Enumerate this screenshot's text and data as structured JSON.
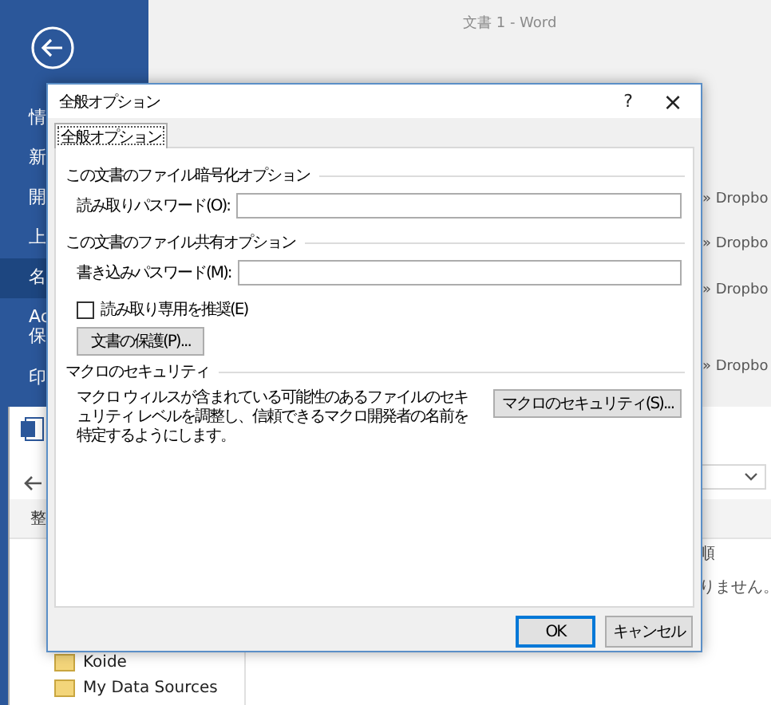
{
  "backstage": {
    "title": "文書 1 - Word",
    "sidebar": [
      {
        "label": "情",
        "selected": false
      },
      {
        "label": "新",
        "selected": false
      },
      {
        "label": "開",
        "selected": false
      },
      {
        "label": "上",
        "selected": false
      },
      {
        "label": "名",
        "selected": true
      },
      {
        "label": "Ac\n保",
        "selected": false
      },
      {
        "label": "印",
        "selected": false
      }
    ],
    "paths": [
      "» Dropbo",
      "» Dropbo",
      "» Dropbo",
      "» Dropbo"
    ]
  },
  "save_dialog": {
    "toolbar_label": "整",
    "column_header": "順",
    "message": "りません。",
    "folders": [
      "Koide",
      "My Data Sources"
    ]
  },
  "dialog": {
    "title": "全般オプション",
    "help": "?",
    "close": "×",
    "tabs": [
      {
        "label": "全般オプション",
        "selected": true
      }
    ],
    "sections": [
      {
        "kind": "password",
        "heading": "この文書のファイル暗号化オプション",
        "label": "読み取りパスワード(O):"
      },
      {
        "kind": "password",
        "heading": "この文書のファイル共有オプション",
        "label": "書き込みパスワード(M):",
        "checkbox": {
          "label": "読み取り専用を推奨(E)",
          "checked": false
        },
        "button": "文書の保護(P)..."
      },
      {
        "kind": "macro",
        "heading": "マクロのセキュリティ",
        "text": "マクロ ウィルスが含まれている可能性のあるファイルのセキュリティ レベルを調整し、信頼できるマクロ開発者の名前を特定するようにします。",
        "button": "マクロのセキュリティ(S)..."
      }
    ],
    "buttons": [
      {
        "label": "OK",
        "default": true
      },
      {
        "label": "キャンセル",
        "default": false
      }
    ]
  }
}
